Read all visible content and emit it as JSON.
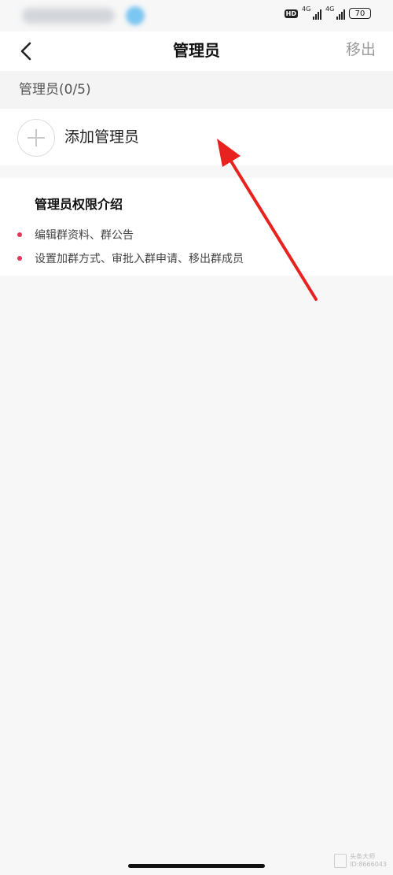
{
  "status_bar": {
    "hd_badge": "HD",
    "signal_1_label": "4G",
    "signal_2_label": "4G",
    "battery": "70"
  },
  "nav": {
    "back_icon": "chevron-left",
    "title": "管理员",
    "move_out": "移出"
  },
  "admins": {
    "count_label": "管理员(0/5)",
    "add_label": "添加管理员",
    "add_icon": "plus"
  },
  "permissions": {
    "title": "管理员权限介绍",
    "items": [
      "编辑群资料、群公告",
      "设置加群方式、审批入群申请、移出群成员"
    ],
    "bullet_color": "#e0365b"
  },
  "watermark": {
    "line1": "头条大师",
    "line2": "ID:8666043"
  },
  "annotation": {
    "arrow_color": "#e8231f"
  }
}
